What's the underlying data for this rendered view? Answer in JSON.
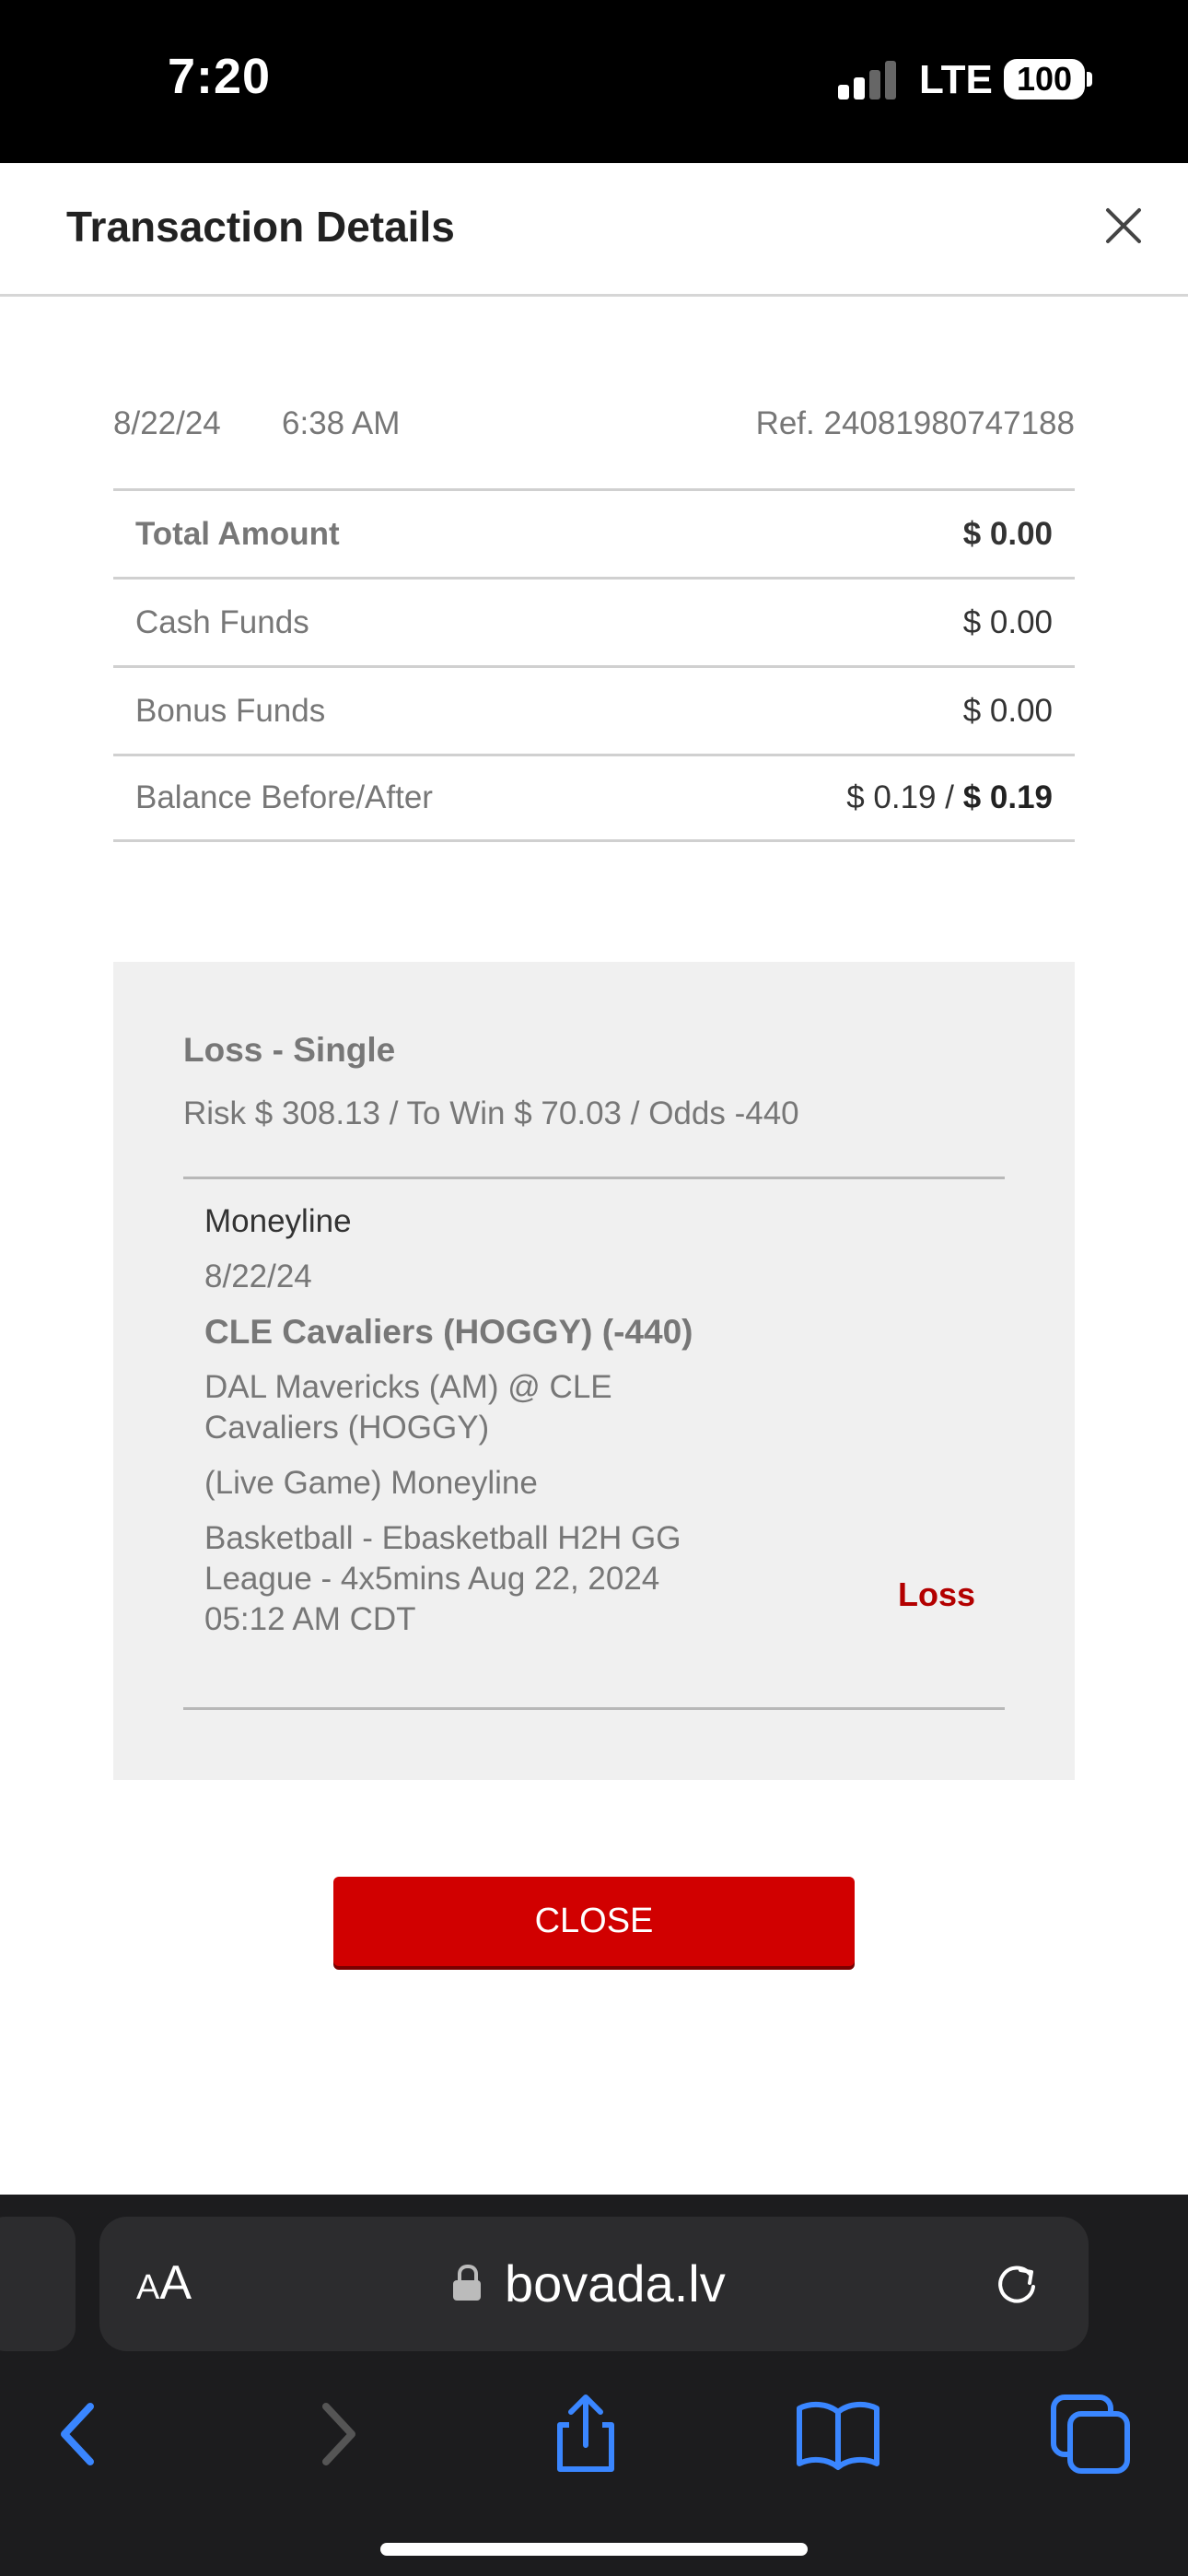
{
  "status_bar": {
    "time": "7:20",
    "network": "LTE",
    "battery": "100"
  },
  "modal": {
    "title": "Transaction Details"
  },
  "transaction": {
    "date": "8/22/24",
    "time": "6:38 AM",
    "ref": "Ref. 24081980747188",
    "rows": [
      {
        "label": "Total Amount",
        "value": "$ 0.00"
      },
      {
        "label": "Cash Funds",
        "value": "$ 0.00"
      },
      {
        "label": "Bonus Funds",
        "value": "$ 0.00"
      },
      {
        "label": "Balance Before/After",
        "before": "$ 0.19 /",
        "after": "$ 0.19"
      }
    ]
  },
  "bet": {
    "type": "Loss - Single",
    "summary": "Risk $ 308.13 / To Win $ 70.03 / Odds -440",
    "leg": {
      "market": "Moneyline",
      "date": "8/22/24",
      "selection": "CLE Cavaliers (HOGGY) (-440)",
      "matchup": "DAL Mavericks (AM) @ CLE Cavaliers (HOGGY)",
      "bet_description": "(Live Game) Moneyline",
      "event_info": "Basketball - Ebasketball H2H GG League - 4x5mins Aug 22, 2024 05:12 AM CDT",
      "result": "Loss"
    }
  },
  "close_button": "CLOSE",
  "browser": {
    "aa_small": "A",
    "aa_large": "A",
    "domain": "bovada.lv"
  },
  "colors": {
    "accent_red": "#d10000",
    "loss_red": "#b30000"
  }
}
